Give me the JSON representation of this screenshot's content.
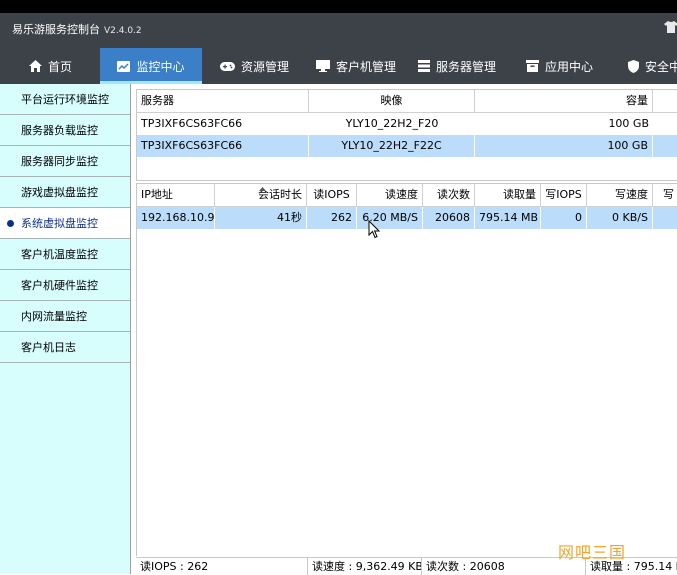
{
  "app": {
    "title": "易乐游服务控制台",
    "version": "V2.4.0.2"
  },
  "nav": [
    {
      "label": "首页",
      "icon": "home-icon"
    },
    {
      "label": "监控中心",
      "icon": "monitor-chart-icon",
      "active": true
    },
    {
      "label": "资源管理",
      "icon": "gamepad-icon"
    },
    {
      "label": "客户机管理",
      "icon": "desktop-icon"
    },
    {
      "label": "服务器管理",
      "icon": "server-icon"
    },
    {
      "label": "应用中心",
      "icon": "box-icon"
    },
    {
      "label": "安全中",
      "icon": "shield-icon"
    }
  ],
  "sidebar": [
    {
      "label": "平台运行环境监控"
    },
    {
      "label": "服务器负载监控"
    },
    {
      "label": "服务器同步监控"
    },
    {
      "label": "游戏虚拟盘监控"
    },
    {
      "label": "系统虚拟盘监控",
      "active": true
    },
    {
      "label": "客户机温度监控"
    },
    {
      "label": "客户机硬件监控"
    },
    {
      "label": "内网流量监控"
    },
    {
      "label": "客户机日志"
    }
  ],
  "server_table": {
    "headers": [
      "服务器",
      "映像",
      "容量"
    ],
    "rows": [
      {
        "server": "TP3IXF6CS63FC66",
        "image": "YLY10_22H2_F20",
        "capacity": "100 GB"
      },
      {
        "server": "TP3IXF6CS63FC66",
        "image": "YLY10_22H2_F22C",
        "capacity": "100 GB",
        "selected": true
      }
    ]
  },
  "session_table": {
    "headers": [
      "IP地址",
      "会话时长",
      "读IOPS",
      "读速度",
      "读次数",
      "读取量",
      "写IOPS",
      "写速度",
      "写"
    ],
    "rows": [
      {
        "ip": "192.168.10.9",
        "duration": "41秒",
        "read_iops": "262",
        "read_speed": "6.20 MB/S",
        "read_count": "20608",
        "read_amount": "795.14 MB",
        "write_iops": "0",
        "write_speed": "0 KB/S",
        "selected": true
      }
    ]
  },
  "status": {
    "read_iops": "读IOPS : 262",
    "read_speed": "读速度 : 9,362.49 KB/",
    "read_count": "读次数 : 20608",
    "read_amount": "读取量 : 795.14 M"
  },
  "watermark": "网吧三国",
  "colors": {
    "nav_bg": "#3d4248",
    "nav_active": "#3a7fc7",
    "sidebar_bg": "#d7fdfd",
    "row_selected": "#bcdcfb"
  }
}
